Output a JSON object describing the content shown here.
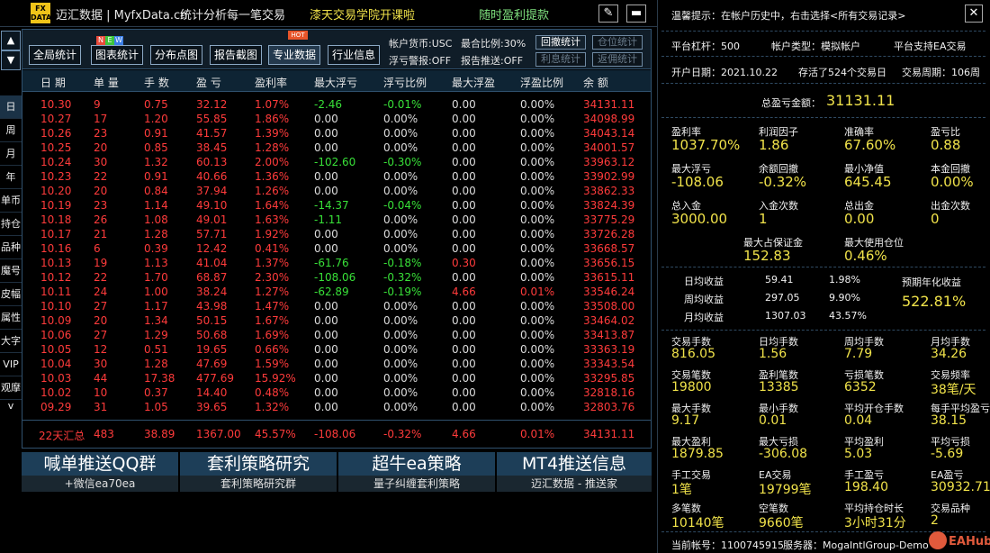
{
  "titlebar": {
    "logo_top": "FX",
    "logo_bottom": "DATA",
    "app": "迈汇数据 | MyfxData.cn",
    "slogan": "统计分析每一笔交易",
    "course": "漆天交易学院开课啦",
    "withdraw": "随时盈利提款",
    "edit_icon": "pencil-icon",
    "min_icon": "minimize-icon"
  },
  "sidebar": {
    "up": "▲",
    "down": "▼",
    "items": [
      "日",
      "周",
      "月",
      "年",
      "单币",
      "持仓",
      "品种",
      "魔号",
      "皮幅",
      "属性",
      "大字",
      "VIP",
      "观摩"
    ],
    "more": "v"
  },
  "toolbar": {
    "buttons": [
      "全局统计",
      "图表统计",
      "分布点图",
      "报告截图",
      "专业数据",
      "行业信息"
    ],
    "badge_new": [
      "N",
      "E",
      "W"
    ],
    "badge_hot": "HOT",
    "currency": "帐户货币:USC",
    "max_ratio": "最合比例:30%",
    "float_alert": "浮亏警报:OFF",
    "report_push": "报告推送:OFF",
    "small": [
      "回撤统计",
      "仓位统计",
      "利息统计",
      "返佣统计"
    ]
  },
  "table": {
    "headers": [
      "日 期",
      "单 量",
      "手 数",
      "盈 亏",
      "盈利率",
      "最大浮亏",
      "浮亏比例",
      "最大浮盈",
      "浮盈比例",
      "余 额"
    ],
    "rows": [
      [
        "10.30",
        "9",
        "0.75",
        "32.12",
        "1.07%",
        "-2.46",
        "-0.01%",
        "0.00",
        "0.00%",
        "34131.11"
      ],
      [
        "10.27",
        "17",
        "1.20",
        "55.85",
        "1.86%",
        "0.00",
        "0.00%",
        "0.00",
        "0.00%",
        "34098.99"
      ],
      [
        "10.26",
        "23",
        "0.91",
        "41.57",
        "1.39%",
        "0.00",
        "0.00%",
        "0.00",
        "0.00%",
        "34043.14"
      ],
      [
        "10.25",
        "20",
        "0.85",
        "38.45",
        "1.28%",
        "0.00",
        "0.00%",
        "0.00",
        "0.00%",
        "34001.57"
      ],
      [
        "10.24",
        "30",
        "1.32",
        "60.13",
        "2.00%",
        "-102.60",
        "-0.30%",
        "0.00",
        "0.00%",
        "33963.12"
      ],
      [
        "10.23",
        "22",
        "0.91",
        "40.66",
        "1.36%",
        "0.00",
        "0.00%",
        "0.00",
        "0.00%",
        "33902.99"
      ],
      [
        "10.20",
        "20",
        "0.84",
        "37.94",
        "1.26%",
        "0.00",
        "0.00%",
        "0.00",
        "0.00%",
        "33862.33"
      ],
      [
        "10.19",
        "23",
        "1.14",
        "49.10",
        "1.64%",
        "-14.37",
        "-0.04%",
        "0.00",
        "0.00%",
        "33824.39"
      ],
      [
        "10.18",
        "26",
        "1.08",
        "49.01",
        "1.63%",
        "-1.11",
        "0.00%",
        "0.00",
        "0.00%",
        "33775.29"
      ],
      [
        "10.17",
        "21",
        "1.28",
        "57.71",
        "1.92%",
        "0.00",
        "0.00%",
        "0.00",
        "0.00%",
        "33726.28"
      ],
      [
        "10.16",
        "6",
        "0.39",
        "12.42",
        "0.41%",
        "0.00",
        "0.00%",
        "0.00",
        "0.00%",
        "33668.57"
      ],
      [
        "10.13",
        "19",
        "1.13",
        "41.04",
        "1.37%",
        "-61.76",
        "-0.18%",
        "0.30",
        "0.00%",
        "33656.15"
      ],
      [
        "10.12",
        "22",
        "1.70",
        "68.87",
        "2.30%",
        "-108.06",
        "-0.32%",
        "0.00",
        "0.00%",
        "33615.11"
      ],
      [
        "10.11",
        "24",
        "1.00",
        "38.24",
        "1.27%",
        "-62.89",
        "-0.19%",
        "4.66",
        "0.01%",
        "33546.24"
      ],
      [
        "10.10",
        "27",
        "1.17",
        "43.98",
        "1.47%",
        "0.00",
        "0.00%",
        "0.00",
        "0.00%",
        "33508.00"
      ],
      [
        "10.09",
        "20",
        "1.34",
        "50.15",
        "1.67%",
        "0.00",
        "0.00%",
        "0.00",
        "0.00%",
        "33464.02"
      ],
      [
        "10.06",
        "27",
        "1.29",
        "50.68",
        "1.69%",
        "0.00",
        "0.00%",
        "0.00",
        "0.00%",
        "33413.87"
      ],
      [
        "10.05",
        "12",
        "0.51",
        "19.65",
        "0.66%",
        "0.00",
        "0.00%",
        "0.00",
        "0.00%",
        "33363.19"
      ],
      [
        "10.04",
        "30",
        "1.28",
        "47.69",
        "1.59%",
        "0.00",
        "0.00%",
        "0.00",
        "0.00%",
        "33343.54"
      ],
      [
        "10.03",
        "44",
        "17.38",
        "477.69",
        "15.92%",
        "0.00",
        "0.00%",
        "0.00",
        "0.00%",
        "33295.85"
      ],
      [
        "10.02",
        "10",
        "0.37",
        "14.40",
        "0.48%",
        "0.00",
        "0.00%",
        "0.00",
        "0.00%",
        "32818.16"
      ],
      [
        "09.29",
        "31",
        "1.05",
        "39.65",
        "1.32%",
        "0.00",
        "0.00%",
        "0.00",
        "0.00%",
        "32803.76"
      ]
    ],
    "summary": [
      "22天汇总",
      "483",
      "38.89",
      "1367.00",
      "45.57%",
      "-108.06",
      "-0.32%",
      "4.66",
      "0.01%",
      "34131.11"
    ]
  },
  "banners": [
    {
      "title": "喊单推送QQ群",
      "sub": "+微信ea70ea"
    },
    {
      "title": "套利策略研究",
      "sub": "套利策略研究群"
    },
    {
      "title": "超牛ea策略",
      "sub": "量子纠缠套利策略"
    },
    {
      "title": "MT4推送信息",
      "sub": "迈汇数据 - 推送家"
    }
  ],
  "right": {
    "tip": "温馨提示：在帐户历史中，右击选择<所有交易记录>",
    "close": "✕",
    "leverage": "平台杠杆：500",
    "acct_type": "帐户类型：模拟帐户",
    "ea_support": "平台支持EA交易",
    "open_date": "开户日期：2021.10.22",
    "stored": "存活了524个交易日",
    "period": "交易周期：106周",
    "total_label": "总盈亏金额：",
    "total_value": "31131.11",
    "grid1": [
      [
        "盈利率",
        "1037.70%"
      ],
      [
        "利润因子",
        "1.86"
      ],
      [
        "准确率",
        "67.60%"
      ],
      [
        "盈亏比",
        "0.88"
      ],
      [
        "最大浮亏",
        "-108.06"
      ],
      [
        "余额回撤",
        "-0.32%"
      ],
      [
        "最小净值",
        "645.45"
      ],
      [
        "本金回撤",
        "0.00%"
      ],
      [
        "总入金",
        "3000.00"
      ],
      [
        "入金次数",
        "1"
      ],
      [
        "总出金",
        "0.00"
      ],
      [
        "出金次数",
        "0"
      ]
    ],
    "margin": [
      [
        "最大占保证金",
        "152.83"
      ],
      [
        "最大使用仓位",
        "0.46%"
      ]
    ],
    "income": [
      [
        "日均收益",
        "59.41",
        "1.98%"
      ],
      [
        "周均收益",
        "297.05",
        "9.90%"
      ],
      [
        "月均收益",
        "1307.03",
        "43.57%"
      ]
    ],
    "annual_label": "预期年化收益",
    "annual_value": "522.81%",
    "grid2": [
      [
        "交易手数",
        "816.05"
      ],
      [
        "日均手数",
        "1.56"
      ],
      [
        "周均手数",
        "7.79"
      ],
      [
        "月均手数",
        "34.26"
      ],
      [
        "交易笔数",
        "19800"
      ],
      [
        "盈利笔数",
        "13385"
      ],
      [
        "亏损笔数",
        "6352"
      ],
      [
        "交易频率",
        "38笔/天"
      ],
      [
        "最大手数",
        "9.17"
      ],
      [
        "最小手数",
        "0.01"
      ],
      [
        "平均开仓手数",
        "0.04"
      ],
      [
        "每手平均盈亏",
        "38.15"
      ],
      [
        "最大盈利",
        "1879.85"
      ],
      [
        "最大亏损",
        "-306.08"
      ],
      [
        "平均盈利",
        "5.03"
      ],
      [
        "平均亏损",
        "-5.69"
      ],
      [
        "手工交易",
        "1笔"
      ],
      [
        "EA交易",
        "19799笔"
      ],
      [
        "手工盈亏",
        "198.40"
      ],
      [
        "EA盈亏",
        "30932.71"
      ],
      [
        "多笔数",
        "10140笔"
      ],
      [
        "空笔数",
        "9660笔"
      ],
      [
        "平均持仓时长",
        "3小时31分"
      ],
      [
        "交易品种",
        "2"
      ]
    ],
    "footer_acct": "当前帐号：1100745915",
    "footer_server": "服务器：MogaIntlGroup-Demo",
    "watermark": "EAHub"
  }
}
